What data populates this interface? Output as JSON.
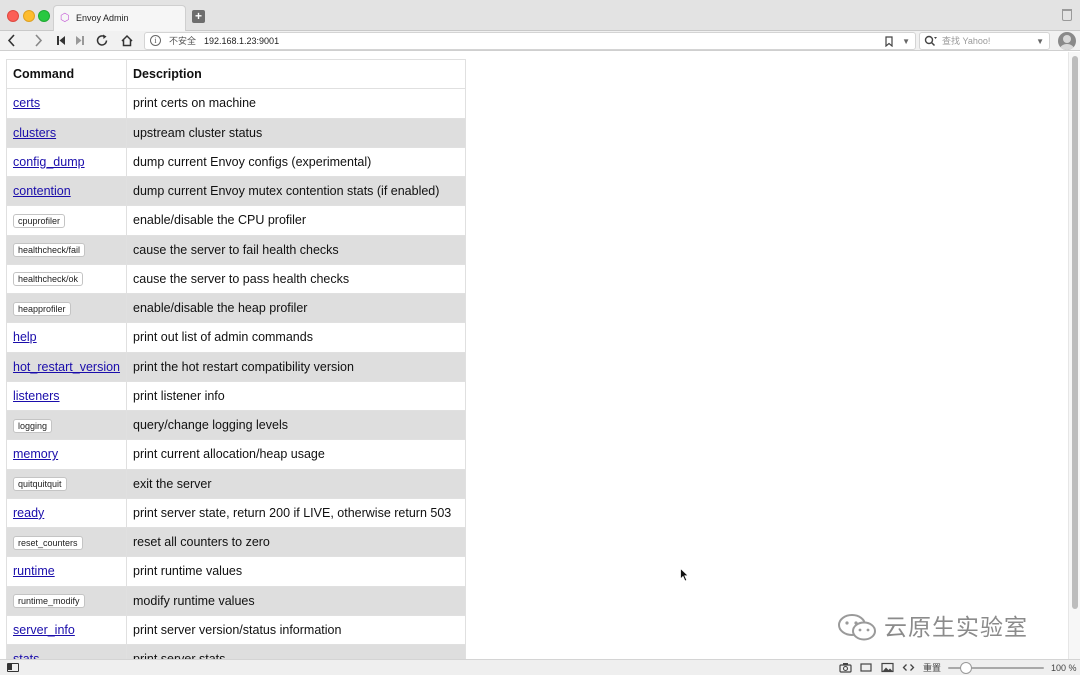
{
  "tab": {
    "title": "Envoy Admin",
    "favicon": "envoy-hexagon-icon"
  },
  "address_bar": {
    "insecure_label": "不安全",
    "url": "192.168.1.23:9001"
  },
  "search_bar": {
    "placeholder": "查找 Yahoo!"
  },
  "table": {
    "headers": [
      "Command",
      "Description"
    ],
    "rows": [
      {
        "command": "certs",
        "kind": "link",
        "description": "print certs on machine"
      },
      {
        "command": "clusters",
        "kind": "link",
        "description": "upstream cluster status"
      },
      {
        "command": "config_dump",
        "kind": "link",
        "description": "dump current Envoy configs (experimental)"
      },
      {
        "command": "contention",
        "kind": "link",
        "description": "dump current Envoy mutex contention stats (if enabled)"
      },
      {
        "command": "cpuprofiler",
        "kind": "button",
        "description": "enable/disable the CPU profiler"
      },
      {
        "command": "healthcheck/fail",
        "kind": "button",
        "description": "cause the server to fail health checks"
      },
      {
        "command": "healthcheck/ok",
        "kind": "button",
        "description": "cause the server to pass health checks"
      },
      {
        "command": "heapprofiler",
        "kind": "button",
        "description": "enable/disable the heap profiler"
      },
      {
        "command": "help",
        "kind": "link",
        "description": "print out list of admin commands"
      },
      {
        "command": "hot_restart_version",
        "kind": "link",
        "description": "print the hot restart compatibility version"
      },
      {
        "command": "listeners",
        "kind": "link",
        "description": "print listener info"
      },
      {
        "command": "logging",
        "kind": "button",
        "description": "query/change logging levels"
      },
      {
        "command": "memory",
        "kind": "link",
        "description": "print current allocation/heap usage"
      },
      {
        "command": "quitquitquit",
        "kind": "button",
        "description": "exit the server"
      },
      {
        "command": "ready",
        "kind": "link",
        "description": "print server state, return 200 if LIVE, otherwise return 503"
      },
      {
        "command": "reset_counters",
        "kind": "button",
        "description": "reset all counters to zero"
      },
      {
        "command": "runtime",
        "kind": "link",
        "description": "print runtime values"
      },
      {
        "command": "runtime_modify",
        "kind": "button",
        "description": "modify runtime values"
      },
      {
        "command": "server_info",
        "kind": "link",
        "description": "print server version/status information"
      },
      {
        "command": "stats",
        "kind": "link",
        "description": "print server stats"
      }
    ]
  },
  "watermark": {
    "text": "云原生实验室"
  },
  "status_bar": {
    "reset_label": "重置",
    "zoom": "100 %"
  },
  "colors": {
    "link": "#1a0dab",
    "row_shade": "#dedede"
  }
}
